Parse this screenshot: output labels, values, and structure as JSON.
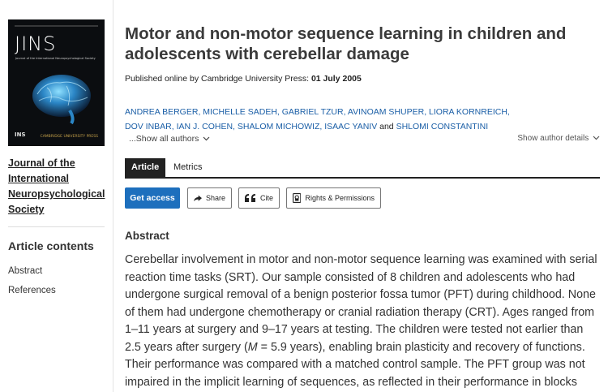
{
  "sidebar": {
    "cover": {
      "journal_abbrev": "JINS",
      "journal_subtitle": "Journal of the International Neuropsychological Society",
      "footer_logo": "INS",
      "publisher_mark": "CAMBRIDGE UNIVERSITY PRESS"
    },
    "journal_link": "Journal of the International Neuropsychological Society",
    "contents_heading": "Article contents",
    "contents_items": [
      "Abstract",
      "References"
    ]
  },
  "article": {
    "title": "Motor and non-motor sequence learning in children and adolescents with cerebellar damage",
    "published_prefix": "Published online by Cambridge University Press:",
    "published_date": "01 July 2005",
    "authors": [
      "ANDREA BERGER",
      "MICHELLE SADEH",
      "GABRIEL TZUR",
      "AVINOAM SHUPER",
      "LIORA KORNREICH",
      "DOV INBAR",
      "IAN J. COHEN",
      "SHALOM MICHOWIZ",
      "ISAAC YANIV",
      "SHLOMI CONSTANTINI"
    ],
    "author_conjunction": "and",
    "show_all_authors": "...Show all authors",
    "show_author_details": "Show author details"
  },
  "tabs": [
    "Article",
    "Metrics"
  ],
  "actions": {
    "get_access": "Get access",
    "share": "Share",
    "cite": "Cite",
    "rights": "Rights & Permissions"
  },
  "abstract": {
    "heading": "Abstract",
    "text_before_M": "Cerebellar involvement in motor and non-motor sequence learning was examined with serial reaction time tasks (SRT). Our sample consisted of 8 children and adolescents who had undergone surgical removal of a benign posterior fossa tumor (PFT) during childhood. None of them had undergone chemotherapy or cranial radiation therapy (CRT). Ages ranged from 1–11 years at surgery and 9–17 years at testing. The children were tested not earlier than 2.5 years after surgery (",
    "M_symbol": "M",
    "text_after_M": " = 5.9 years), enabling brain plasticity and recovery of functions. Their performance was compared with a matched control sample. The PFT group was not impaired in the implicit learning of sequences, as reflected in their performance in blocks with a"
  },
  "colors": {
    "accent": "#1d6fbd",
    "author_link": "#1a5ea6",
    "tab_active_bg": "#222222",
    "cover_bg": "#0b0d10"
  },
  "icons": {
    "share": "arrow-share-icon",
    "cite": "quote-icon",
    "rights": "document-lock-icon",
    "chevron": "chevron-down-icon"
  }
}
